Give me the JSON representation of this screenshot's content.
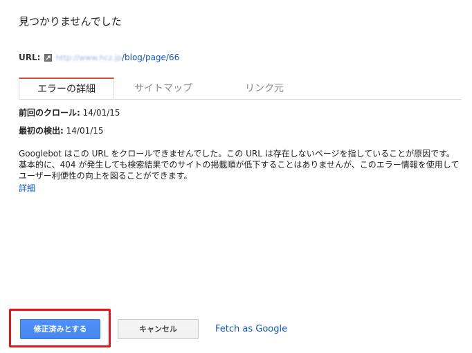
{
  "dialog": {
    "title": "見つかりませんでした"
  },
  "url": {
    "label": "URL:",
    "host": "http://www.hcz.jp",
    "path": "/blog/page/66"
  },
  "tabs": [
    {
      "label": "エラーの詳細",
      "active": true
    },
    {
      "label": "サイトマップ",
      "active": false
    },
    {
      "label": "リンク元",
      "active": false
    }
  ],
  "details": {
    "last_crawl_label": "前回のクロール:",
    "last_crawl_value": "14/01/15",
    "first_detected_label": "最初の検出:",
    "first_detected_value": "14/01/15",
    "description": "Googlebot はこの URL をクロールできませんでした。この URL は存在しないページを指していることが原因です。基本的に、404 が発生しても検索結果でのサイトの掲載順が低下することはありませんが、このエラー情報を使用してユーザー利便性の向上を図ることができます。",
    "more_link": "詳細"
  },
  "actions": {
    "mark_fixed_label": "修正済みとする",
    "cancel_label": "キャンセル",
    "fetch_label": "Fetch as Google"
  },
  "colors": {
    "primary_button": "#4d90fe",
    "active_tab_accent": "#dd4b39",
    "highlight_box": "#e8131b",
    "link": "#1155cc"
  }
}
